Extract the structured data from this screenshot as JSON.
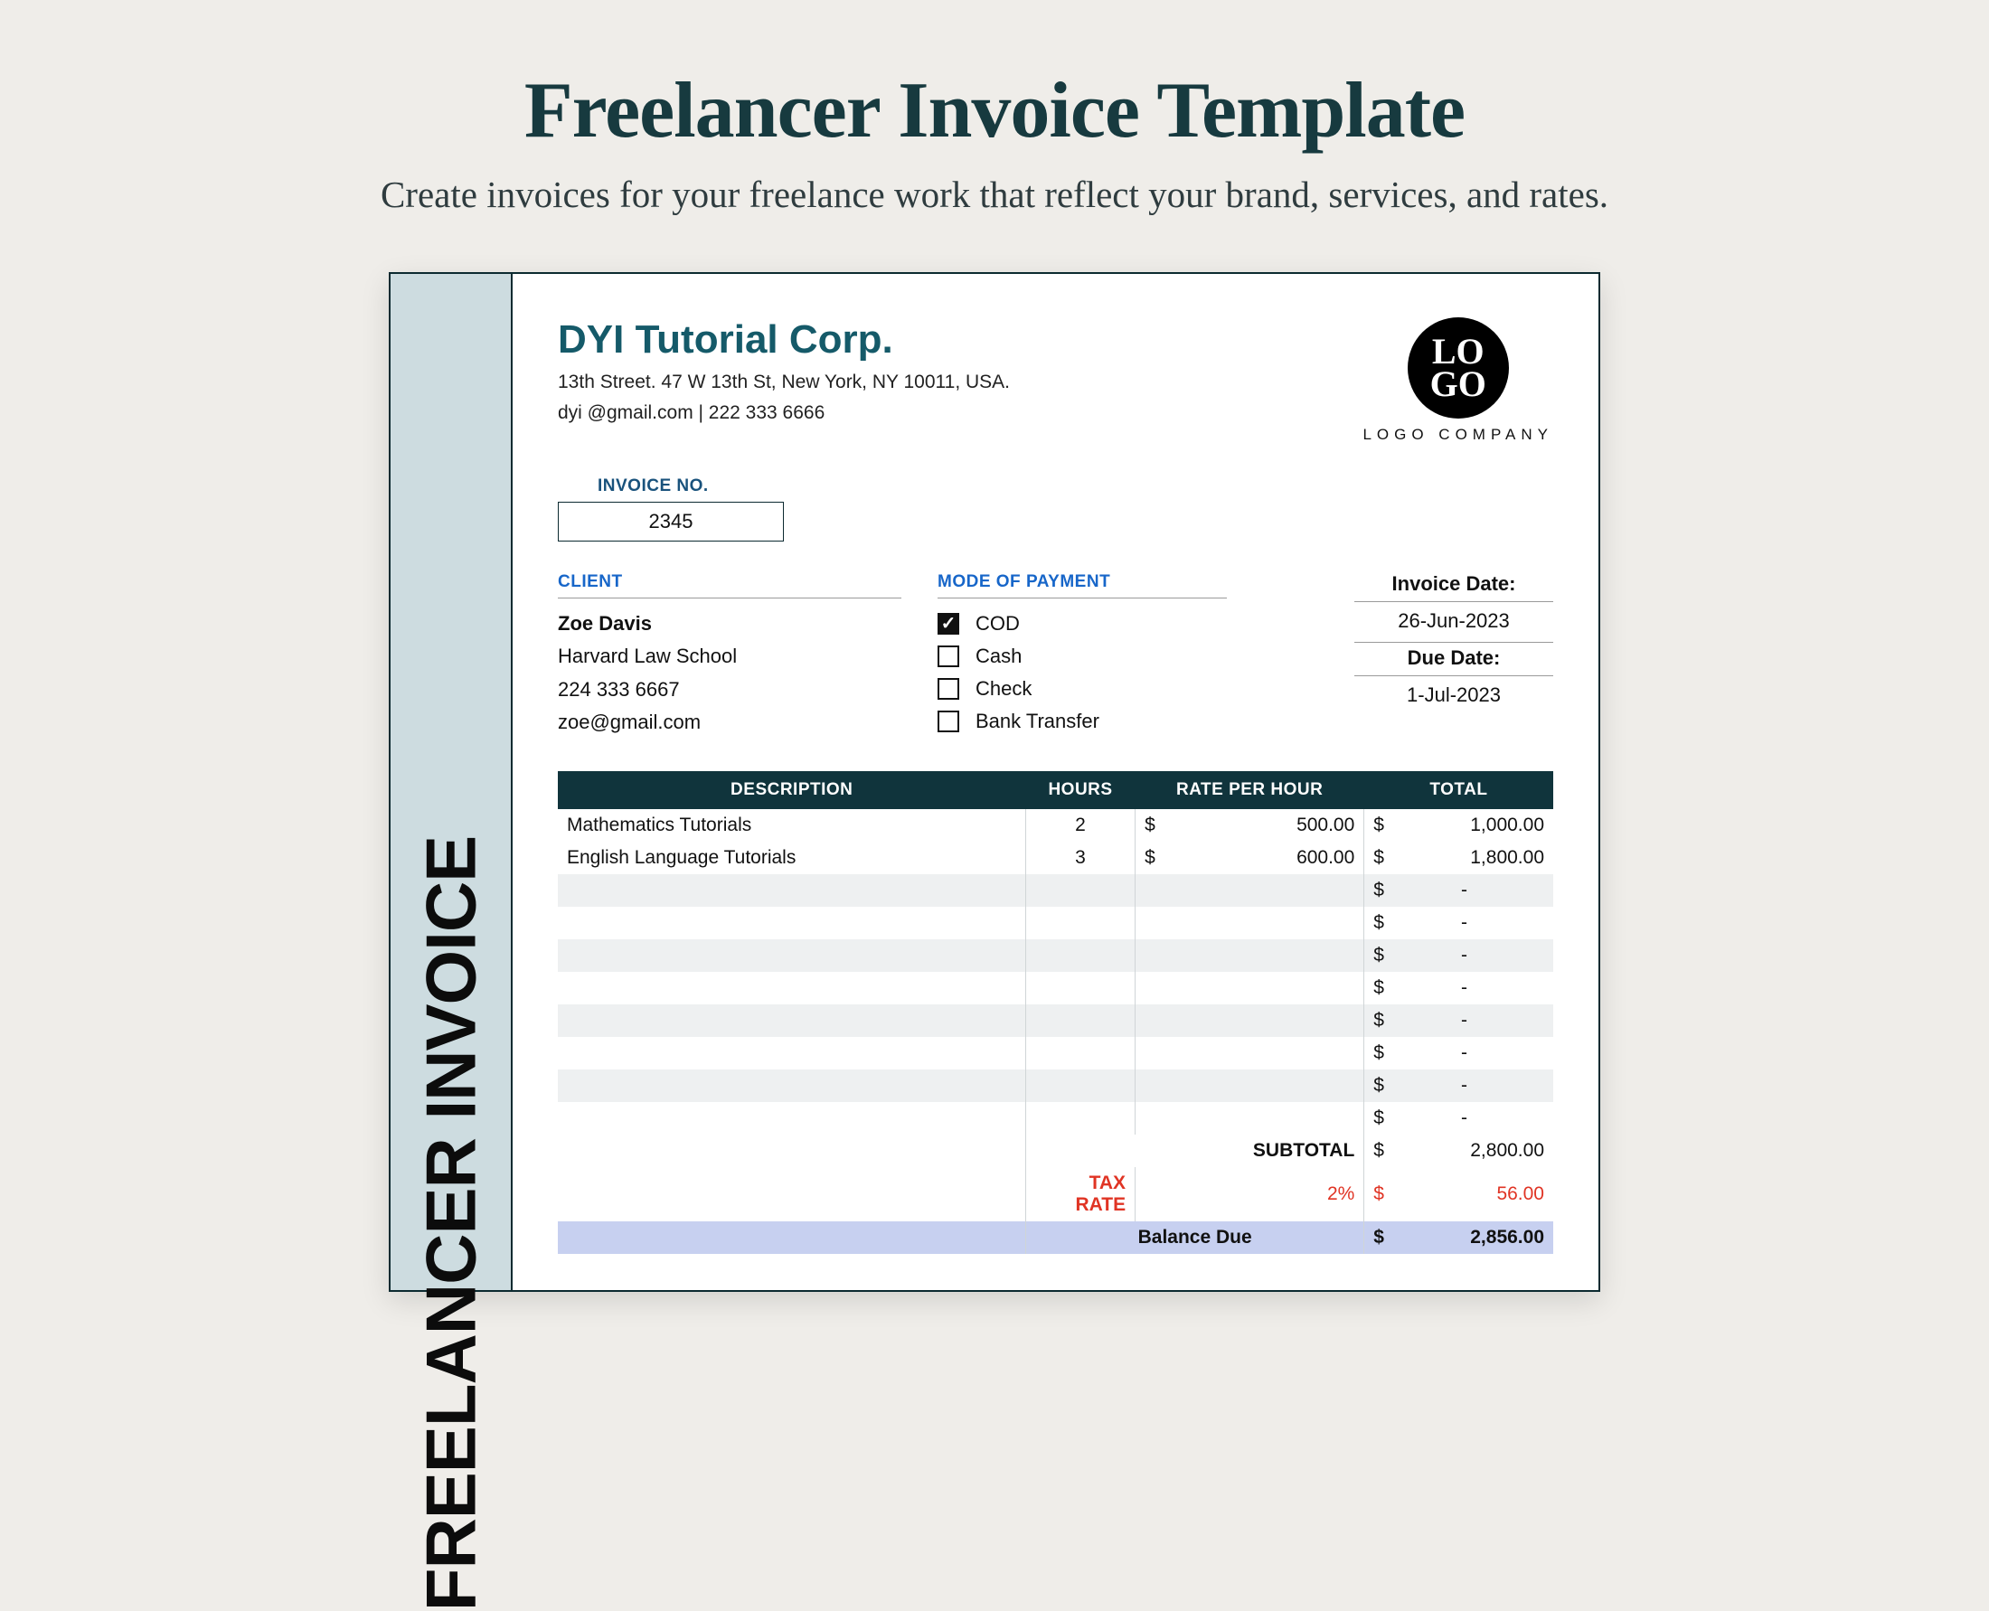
{
  "header": {
    "title": "Freelancer Invoice Template",
    "subtitle": "Create invoices for your freelance work that reflect your brand, services, and rates."
  },
  "side_label": "FREELANCER INVOICE",
  "company": {
    "name": "DYI Tutorial Corp.",
    "address": "13th Street. 47 W 13th St, New York, NY 10011, USA.",
    "contact": "dyi @gmail.com | 222 333 6666"
  },
  "logo": {
    "line1": "LO",
    "line2": "GO",
    "caption": "LOGO COMPANY"
  },
  "invoice_no": {
    "label": "INVOICE NO.",
    "value": "2345"
  },
  "client": {
    "label": "CLIENT",
    "name": "Zoe Davis",
    "org": "Harvard Law School",
    "phone": "224 333 6667",
    "email": "zoe@gmail.com"
  },
  "payment": {
    "label": "MODE OF PAYMENT",
    "options": [
      {
        "label": "COD",
        "checked": true
      },
      {
        "label": "Cash",
        "checked": false
      },
      {
        "label": "Check",
        "checked": false
      },
      {
        "label": "Bank Transfer",
        "checked": false
      }
    ]
  },
  "dates": {
    "invoice_label": "Invoice Date:",
    "invoice_value": "26-Jun-2023",
    "due_label": "Due Date:",
    "due_value": "1-Jul-2023"
  },
  "table": {
    "headers": {
      "desc": "DESCRIPTION",
      "hours": "HOURS",
      "rate": "RATE PER HOUR",
      "total": "TOTAL"
    },
    "rows": [
      {
        "desc": "Mathematics Tutorials",
        "hours": "2",
        "rate": "500.00",
        "total": "1,000.00"
      },
      {
        "desc": "English Language Tutorials",
        "hours": "3",
        "rate": "600.00",
        "total": "1,800.00"
      },
      {
        "desc": "",
        "hours": "",
        "rate": "",
        "total": "-"
      },
      {
        "desc": "",
        "hours": "",
        "rate": "",
        "total": "-"
      },
      {
        "desc": "",
        "hours": "",
        "rate": "",
        "total": "-"
      },
      {
        "desc": "",
        "hours": "",
        "rate": "",
        "total": "-"
      },
      {
        "desc": "",
        "hours": "",
        "rate": "",
        "total": "-"
      },
      {
        "desc": "",
        "hours": "",
        "rate": "",
        "total": "-"
      },
      {
        "desc": "",
        "hours": "",
        "rate": "",
        "total": "-"
      },
      {
        "desc": "",
        "hours": "",
        "rate": "",
        "total": "-"
      }
    ],
    "currency": "$"
  },
  "totals": {
    "subtotal_label": "SUBTOTAL",
    "subtotal_value": "2,800.00",
    "tax_label": "TAX RATE",
    "tax_pct": "2%",
    "tax_value": "56.00",
    "balance_label": "Balance Due",
    "balance_value": "2,856.00"
  }
}
